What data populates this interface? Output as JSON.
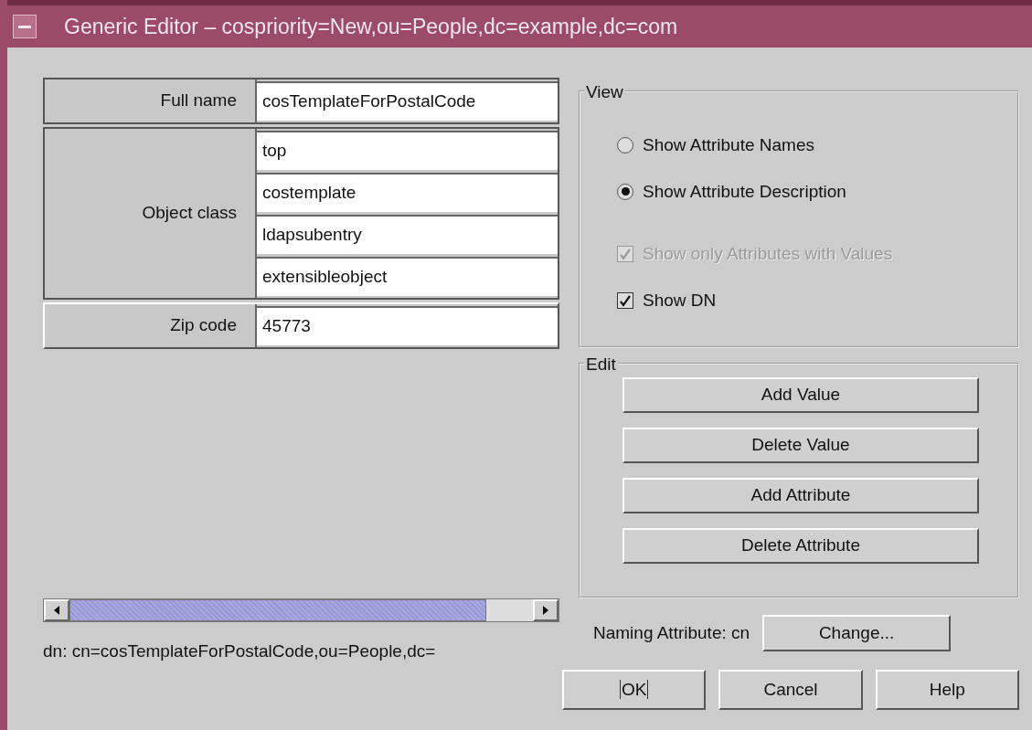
{
  "window": {
    "title": "Generic Editor – cospriority=New,ou=People,dc=example,dc=com"
  },
  "attributes": [
    {
      "label": "Full name",
      "values": [
        "cosTemplateForPostalCode"
      ],
      "selected": false
    },
    {
      "label": "Object class",
      "values": [
        "top",
        "costemplate",
        "ldapsubentry",
        "extensibleobject"
      ],
      "selected": false
    },
    {
      "label": "Zip code",
      "values": [
        "45773"
      ],
      "selected": true
    }
  ],
  "dn": "dn: cn=cosTemplateForPostalCode,ou=People,dc=",
  "view": {
    "title": "View",
    "options": [
      {
        "kind": "radio",
        "label": "Show Attribute Names",
        "checked": false,
        "disabled": false
      },
      {
        "kind": "radio",
        "label": "Show Attribute Description",
        "checked": true,
        "disabled": false
      },
      {
        "kind": "checkbox",
        "label": "Show only Attributes with Values",
        "checked": true,
        "disabled": true
      },
      {
        "kind": "checkbox",
        "label": "Show DN",
        "checked": true,
        "disabled": false
      }
    ]
  },
  "edit": {
    "title": "Edit",
    "buttons": [
      {
        "label": "Add Value"
      },
      {
        "label": "Delete Value"
      },
      {
        "label": "Add Attribute"
      },
      {
        "label": "Delete Attribute"
      }
    ]
  },
  "naming": {
    "label": "Naming Attribute: cn",
    "button": {
      "label": "Change..."
    }
  },
  "buttons": [
    {
      "label": "OK",
      "focused": true
    },
    {
      "label": "Cancel",
      "focused": false
    },
    {
      "label": "Help",
      "focused": false
    }
  ]
}
